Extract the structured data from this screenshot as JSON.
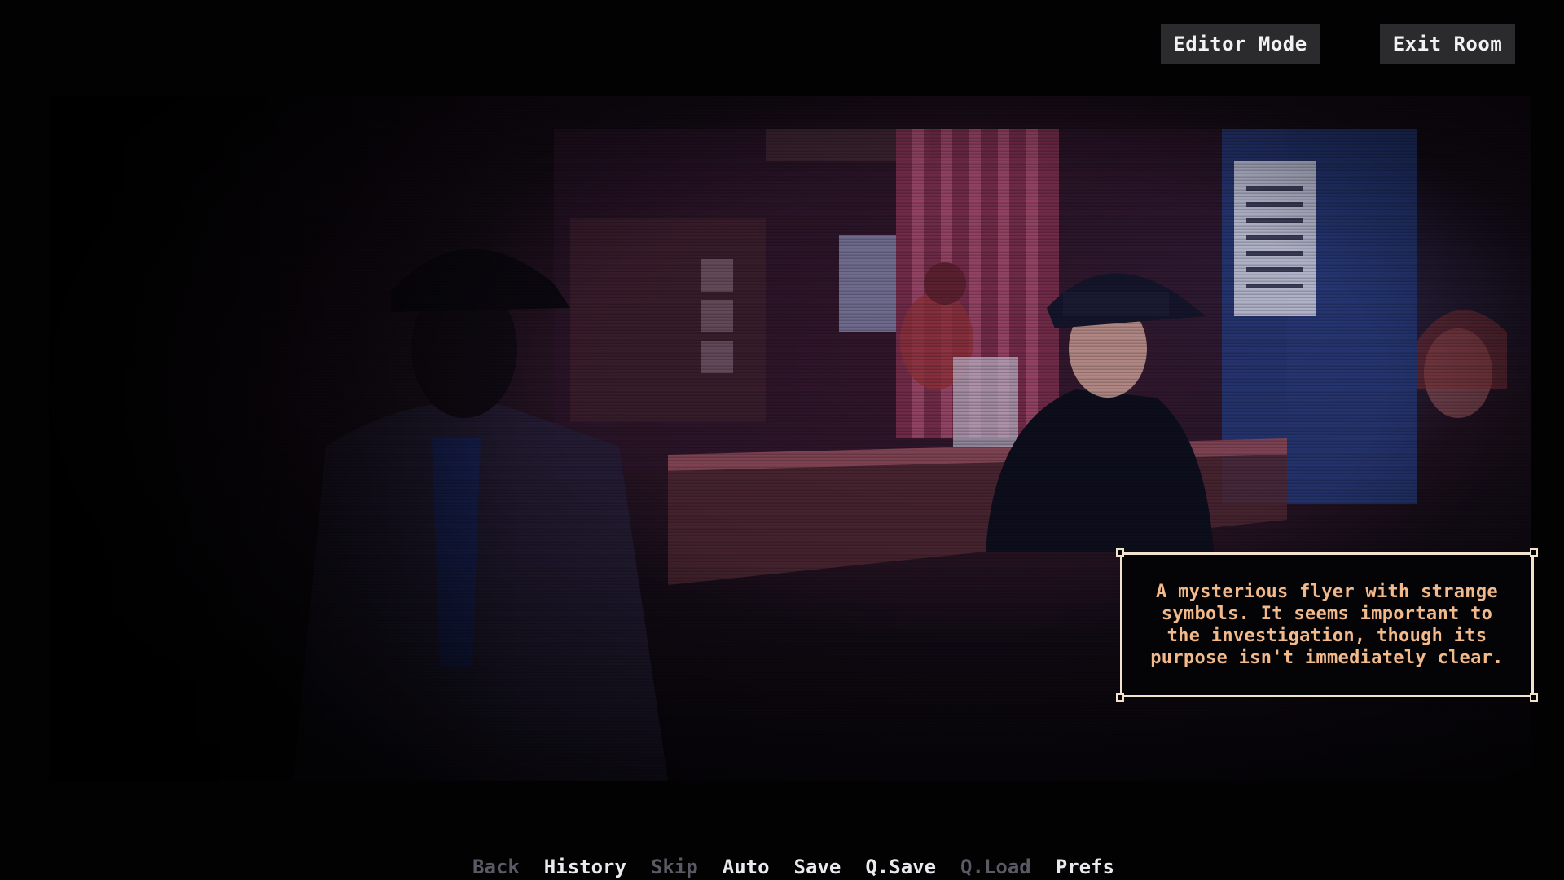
{
  "top_bar": {
    "editor_mode_label": "Editor Mode",
    "exit_room_label": "Exit Room"
  },
  "description_box": {
    "text": "A mysterious flyer with strange symbols. It seems important to the investigation, though its purpose isn't immediately clear.",
    "text_color": "#f2b98a",
    "border_color": "#f3e2cc"
  },
  "quick_menu": {
    "items": [
      {
        "label": "Back",
        "enabled": false
      },
      {
        "label": "History",
        "enabled": true
      },
      {
        "label": "Skip",
        "enabled": false
      },
      {
        "label": "Auto",
        "enabled": true
      },
      {
        "label": "Save",
        "enabled": true
      },
      {
        "label": "Q.Save",
        "enabled": true
      },
      {
        "label": "Q.Load",
        "enabled": false
      },
      {
        "label": "Prefs",
        "enabled": true
      }
    ]
  },
  "scene": {
    "setting": "noir diner",
    "colors": {
      "magenta_light": "#8a3a5e",
      "blue_light": "#2a3f86"
    }
  }
}
